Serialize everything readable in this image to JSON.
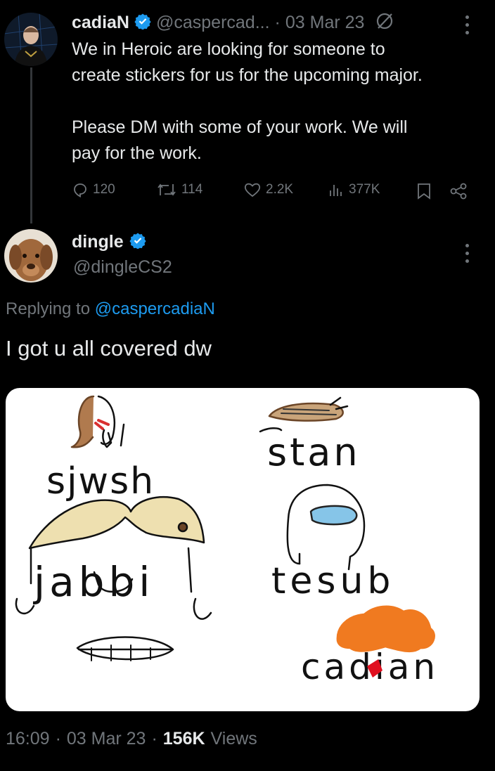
{
  "parent_tweet": {
    "author_name": "cadiaN",
    "author_handle": "@caspercad...",
    "separator": "·",
    "date": "03 Mar 23",
    "text_lines": [
      "We in Heroic are looking for someone to",
      "create stickers for us for the upcoming major.",
      "",
      "Please DM with some of your work. We will",
      "pay for the work."
    ],
    "replies": "120",
    "retweets": "114",
    "likes": "2.2K",
    "views": "377K",
    "icons": [
      "slash-circle-icon",
      "more-icon",
      "reply-icon",
      "retweet-icon",
      "like-icon",
      "views-icon",
      "bookmark-icon",
      "share-icon"
    ]
  },
  "main_tweet": {
    "author_name": "dingle",
    "author_handle": "@dingleCS2",
    "replying_to_prefix": "Replying to",
    "replying_to_handle": "@caspercadiaN",
    "text": "I got u all covered dw",
    "image_words": [
      "sjwsh",
      "stan",
      "jabbi",
      "tesub",
      "cadian"
    ],
    "timestamp_time": "16:09",
    "timestamp_sep1": "·",
    "timestamp_date": "03 Mar 23",
    "timestamp_sep2": "·",
    "views_count": "156K",
    "views_label": "Views"
  },
  "colors": {
    "background": "#000000",
    "text": "#e7e9ea",
    "muted": "#71767b",
    "accent": "#1d9bf0",
    "verified": "#1d9bf0"
  }
}
